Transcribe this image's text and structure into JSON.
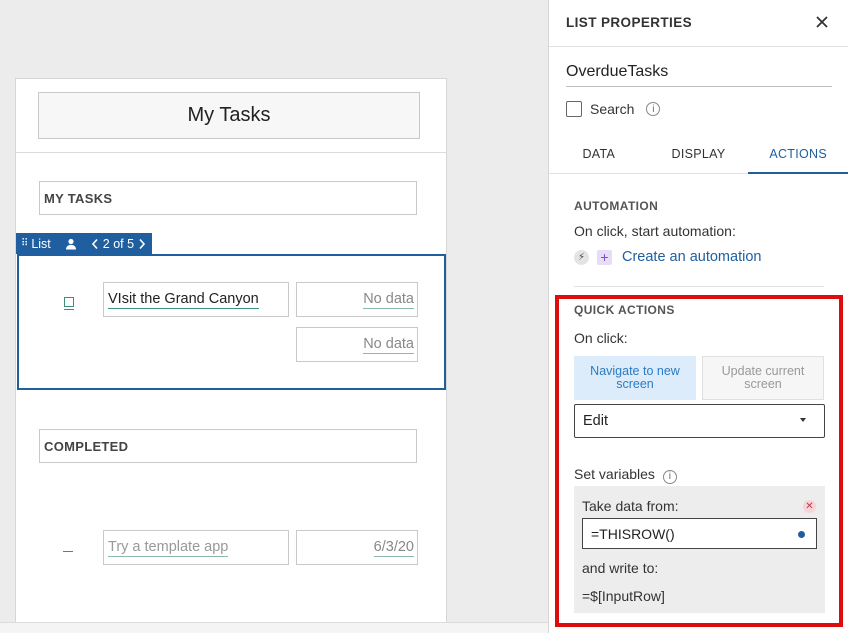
{
  "app": {
    "title": "My Tasks",
    "sections": [
      {
        "header": "MY TASKS"
      },
      {
        "header": "COMPLETED"
      }
    ],
    "list_badge": {
      "label": "List",
      "pager": "2 of 5",
      "icons": [
        "drag-handle-icon",
        "person-icon",
        "chevron-left-icon",
        "chevron-right-icon"
      ]
    },
    "list_item": {
      "title": "VIsit the Grand Canyon",
      "field1": "No data",
      "field2": "No data"
    },
    "completed_item": {
      "title": "Try a template app",
      "date": "6/3/20"
    }
  },
  "panel": {
    "title": "LIST PROPERTIES",
    "close_icon": "close-icon",
    "name": "OverdueTasks",
    "search_label": "Search",
    "search_checked": false,
    "tabs": [
      "DATA",
      "DISPLAY",
      "ACTIONS"
    ],
    "active_tab": "ACTIONS",
    "automation": {
      "header": "AUTOMATION",
      "subtitle": "On click, start automation:",
      "link": "Create an automation"
    },
    "quick_actions": {
      "header": "QUICK ACTIONS",
      "on_click_label": "On click:",
      "buttons": [
        "Navigate to new screen",
        "Update current screen"
      ],
      "selected_button": "Navigate to new screen",
      "screen_select": "Edit",
      "set_variables_label": "Set variables",
      "take_data_label": "Take data from:",
      "take_data_value": "=THISROW()",
      "write_to_label": "and write to:",
      "write_to_value": "=$[InputRow]"
    }
  },
  "colors": {
    "accent": "#1f5fa0",
    "highlight_border": "#dd0d0d",
    "active_button_bg": "#dcecfa"
  }
}
